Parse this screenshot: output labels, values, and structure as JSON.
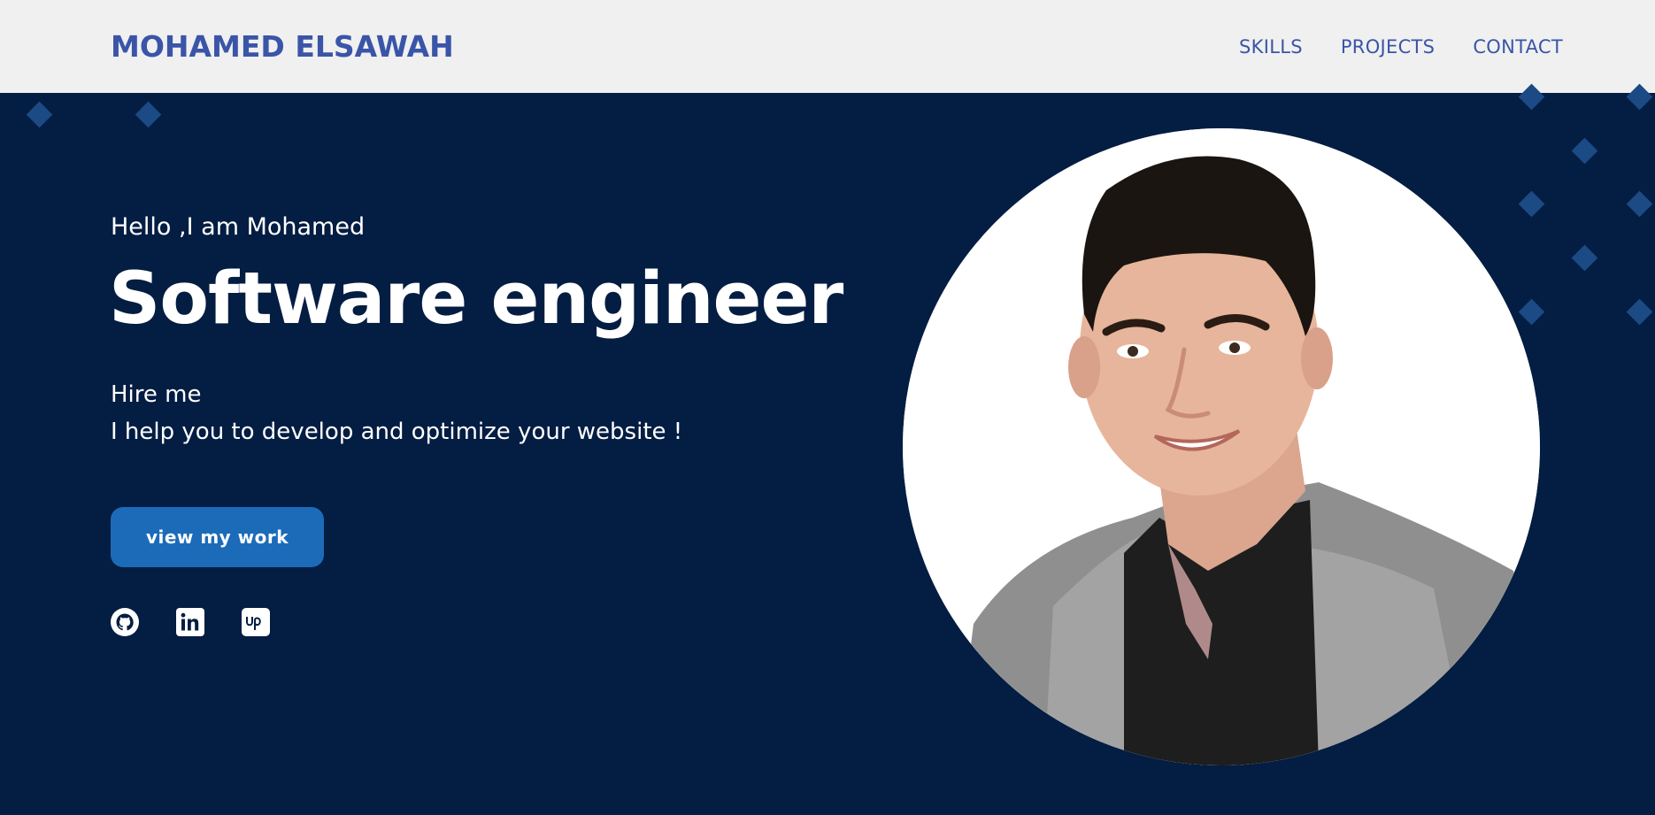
{
  "header": {
    "brand": "MOHAMED ELSAWAH",
    "nav": [
      {
        "label": "SKILLS"
      },
      {
        "label": "PROJECTS"
      },
      {
        "label": "CONTACT"
      }
    ]
  },
  "hero": {
    "greeting": "Hello ,I am Mohamed",
    "title": "Software engineer",
    "tagline_line1": "Hire me",
    "tagline_line2": "I help you to develop and optimize your website !",
    "cta_label": "view my work",
    "socials": [
      {
        "icon": "github-icon"
      },
      {
        "icon": "linkedin-icon"
      },
      {
        "icon": "upwork-icon"
      }
    ],
    "portrait_alt": "Mohamed Elsawah"
  },
  "colors": {
    "header_bg": "#f0f0f0",
    "brand": "#3a55a8",
    "hero_bg": "#041d42",
    "button": "#1c6bb9",
    "diamond": "#1b4a85"
  }
}
